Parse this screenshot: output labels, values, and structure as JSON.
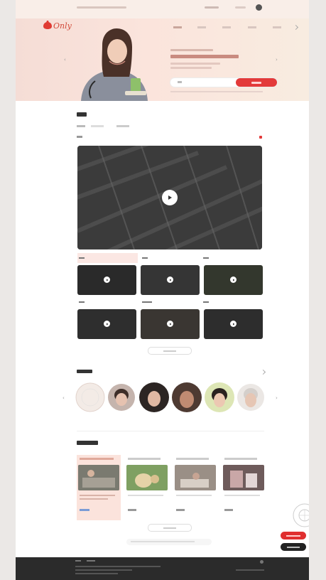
{
  "brand": {
    "logo_text": "Only",
    "accent": "#e33a3a"
  },
  "hero": {
    "headline": "",
    "subtext": "",
    "search_placeholder": "",
    "search_button": ""
  },
  "section_videos": {
    "title": "",
    "more_label": ""
  },
  "section_people": {
    "title": ""
  },
  "section_donation": {
    "title": "",
    "more_label": ""
  },
  "floating": {
    "primary": "",
    "secondary": ""
  },
  "icons": [
    "play-icon",
    "chevron-left-icon",
    "chevron-right-icon",
    "chat-icon",
    "user-icon"
  ]
}
